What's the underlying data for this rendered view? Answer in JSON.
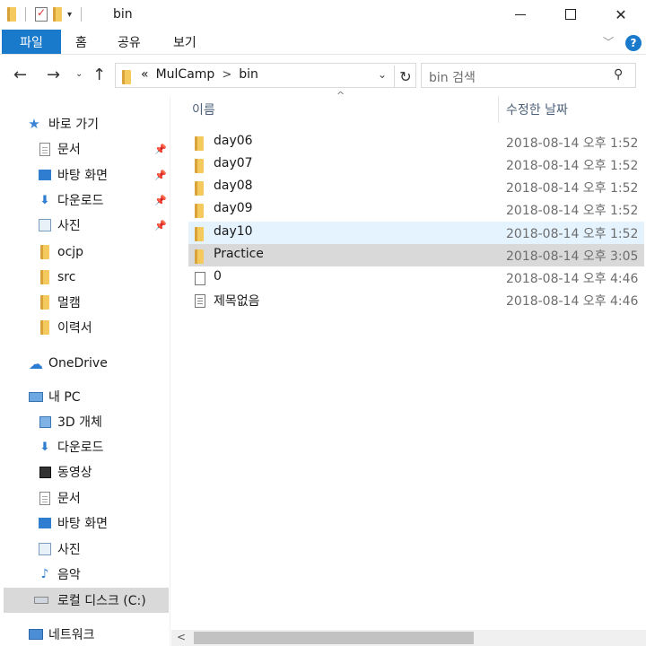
{
  "window": {
    "title": "bin"
  },
  "ribbon": {
    "file_tab": "파일",
    "home_tab": "홈",
    "share_tab": "공유",
    "view_tab": "보기"
  },
  "address": {
    "overflow": "«",
    "crumbs": [
      "MulCamp",
      "bin"
    ],
    "separator": ">"
  },
  "search": {
    "placeholder": "bin 검색"
  },
  "columns": {
    "name": "이름",
    "date": "수정한 날짜"
  },
  "nav": {
    "quick_access": "바로 가기",
    "quick_items": [
      "문서",
      "바탕 화면",
      "다운로드",
      "사진"
    ],
    "folders": [
      "ocjp",
      "src",
      "멀캠",
      "이력서"
    ],
    "onedrive": "OneDrive",
    "this_pc": "내 PC",
    "pc_items": [
      "3D 개체",
      "다운로드",
      "동영상",
      "문서",
      "바탕 화면",
      "사진",
      "음악",
      "로컬 디스크 (C:)"
    ],
    "network": "네트워크"
  },
  "files": [
    {
      "name": "day06",
      "date": "2018-08-14 오후 1:52",
      "type": "folder",
      "state": "normal"
    },
    {
      "name": "day07",
      "date": "2018-08-14 오후 1:52",
      "type": "folder",
      "state": "normal"
    },
    {
      "name": "day08",
      "date": "2018-08-14 오후 1:52",
      "type": "folder",
      "state": "normal"
    },
    {
      "name": "day09",
      "date": "2018-08-14 오후 1:52",
      "type": "folder",
      "state": "normal"
    },
    {
      "name": "day10",
      "date": "2018-08-14 오후 1:52",
      "type": "folder",
      "state": "hover"
    },
    {
      "name": "Practice",
      "date": "2018-08-14 오후 3:05",
      "type": "folder",
      "state": "selected"
    },
    {
      "name": "0",
      "date": "2018-08-14 오후 4:46",
      "type": "file",
      "state": "normal"
    },
    {
      "name": "제목없음",
      "date": "2018-08-14 오후 4:46",
      "type": "text",
      "state": "normal"
    }
  ],
  "colors": {
    "accent": "#1979ca",
    "hover": "#e5f3ff",
    "selected": "#d9d9d9",
    "folder": "#e8b84a"
  }
}
